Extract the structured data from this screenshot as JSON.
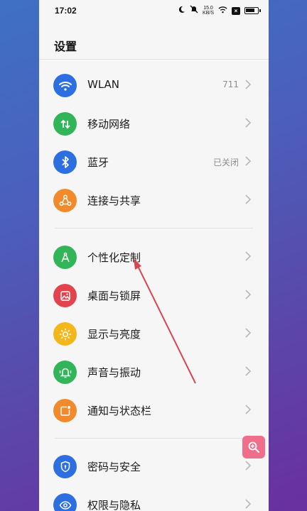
{
  "status_bar": {
    "time": "17:02",
    "network_speed_top": "15.0",
    "network_speed_bottom": "KB/S",
    "x_badge": "×"
  },
  "page": {
    "title": "设置"
  },
  "groups": [
    {
      "items": [
        {
          "label": "WLAN",
          "value": "711",
          "icon": "wifi-icon",
          "color": "#2d6fe0"
        },
        {
          "label": "移动网络",
          "value": "",
          "icon": "mobile-data-icon",
          "color": "#32b558"
        },
        {
          "label": "蓝牙",
          "value": "已关闭",
          "icon": "bluetooth-icon",
          "color": "#2d6fe0"
        },
        {
          "label": "连接与共享",
          "value": "",
          "icon": "share-icon",
          "color": "#f08a2c"
        }
      ]
    },
    {
      "items": [
        {
          "label": "个性化定制",
          "value": "",
          "icon": "personalization-icon",
          "color": "#32b558"
        },
        {
          "label": "桌面与锁屏",
          "value": "",
          "icon": "wallpaper-icon",
          "color": "#e2434c"
        },
        {
          "label": "显示与亮度",
          "value": "",
          "icon": "brightness-icon",
          "color": "#f3b71b"
        },
        {
          "label": "声音与振动",
          "value": "",
          "icon": "bell-icon",
          "color": "#32b558"
        },
        {
          "label": "通知与状态栏",
          "value": "",
          "icon": "notification-icon",
          "color": "#f08a2c"
        }
      ]
    },
    {
      "items": [
        {
          "label": "密码与安全",
          "value": "",
          "icon": "shield-icon",
          "color": "#2d6fe0"
        },
        {
          "label": "权限与隐私",
          "value": "",
          "icon": "eye-icon",
          "color": "#2d6fe0"
        }
      ]
    }
  ],
  "overlay": {
    "zoom_button_icon": "zoom-in-icon",
    "annotation_arrow_color": "#d8454f"
  }
}
